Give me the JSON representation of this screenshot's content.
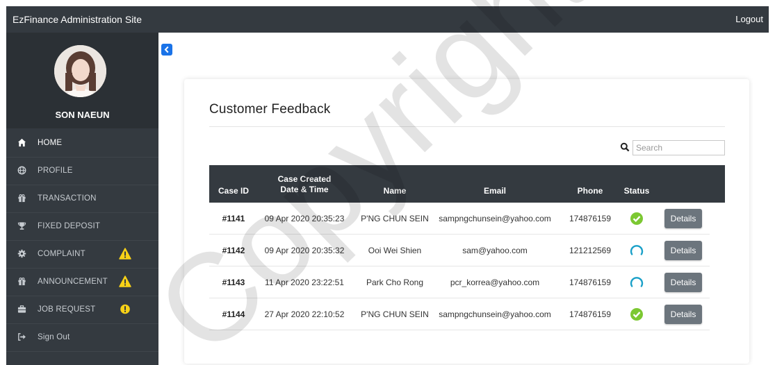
{
  "header": {
    "brand": "EzFinance Administration Site",
    "logout_label": "Logout"
  },
  "sidebar": {
    "user_name": "SON NAEUN",
    "items": [
      {
        "label": "HOME",
        "icon": "home-icon",
        "active": true
      },
      {
        "label": "PROFILE",
        "icon": "globe-icon"
      },
      {
        "label": "TRANSACTION",
        "icon": "gift-icon"
      },
      {
        "label": "FIXED DEPOSIT",
        "icon": "trophy-icon"
      },
      {
        "label": "COMPLAINT",
        "icon": "gear-icon",
        "alert": "warning-triangle-icon"
      },
      {
        "label": "ANNOUNCEMENT",
        "icon": "gift-icon",
        "alert": "warning-triangle-icon"
      },
      {
        "label": "JOB REQUEST",
        "icon": "briefcase-icon",
        "alert": "exclamation-circle-icon"
      },
      {
        "label": "Sign Out",
        "icon": "sign-out-icon"
      }
    ]
  },
  "main": {
    "toggle_icon": "chevron-left-icon",
    "title": "Customer Feedback",
    "search": {
      "placeholder": "Search",
      "value": ""
    },
    "table": {
      "headers": {
        "case_id": "Case ID",
        "created_line1": "Case Created",
        "created_line2": "Date & Time",
        "name": "Name",
        "email": "Email",
        "phone": "Phone",
        "status": "Status"
      },
      "rows": [
        {
          "case_id": "#1141",
          "created": "09 Apr 2020 20:35:23",
          "name": "P'NG CHUN SEIN",
          "email": "sampngchunsein@yahoo.com",
          "phone": "174876159",
          "status": "resolved",
          "action": "Details"
        },
        {
          "case_id": "#1142",
          "created": "09 Apr 2020 20:35:32",
          "name": "Ooi Wei Shien",
          "email": "sam@yahoo.com",
          "phone": "121212569",
          "status": "pending",
          "action": "Details"
        },
        {
          "case_id": "#1143",
          "created": "11 Apr 2020 23:22:51",
          "name": "Park Cho Rong",
          "email": "pcr_korrea@yahoo.com",
          "phone": "174876159",
          "status": "pending",
          "action": "Details"
        },
        {
          "case_id": "#1144",
          "created": "27 Apr 2020 22:10:52",
          "name": "P'NG CHUN SEIN",
          "email": "sampngchunsein@yahoo.com",
          "phone": "174876159",
          "status": "resolved",
          "action": "Details"
        }
      ]
    }
  },
  "colors": {
    "navbar": "#343a40",
    "toggle": "#1a73e8",
    "resolved": "#7cc832",
    "pending": "#1aa0c8",
    "warning": "#f7d117",
    "button": "#6c757d"
  },
  "watermark": {
    "text": "Copyright@FCI"
  }
}
